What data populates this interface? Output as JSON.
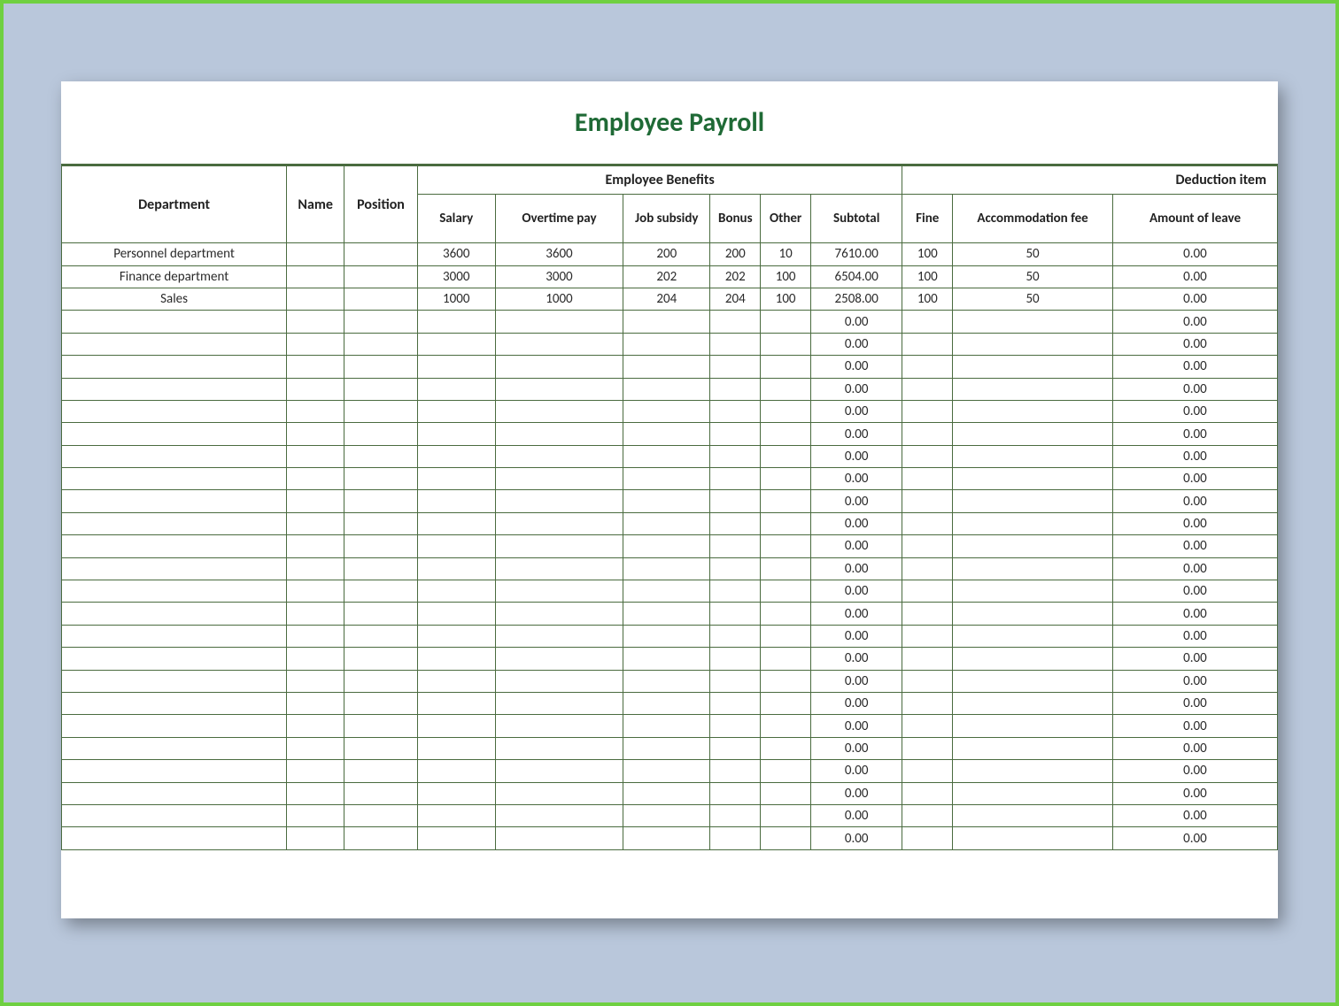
{
  "title": "Employee Payroll",
  "headers": {
    "department": "Department",
    "name": "Name",
    "position": "Position",
    "benefits_group": "Employee Benefits",
    "deduction_group": "Deduction item",
    "salary": "Salary",
    "overtime": "Overtime pay",
    "job_subsidy": "Job subsidy",
    "bonus": "Bonus",
    "other": "Other",
    "subtotal": "Subtotal",
    "fine": "Fine",
    "accommodation": "Accommodation fee",
    "leave": "Amount of leave"
  },
  "rows": [
    {
      "department": "Personnel department",
      "name": "",
      "position": "",
      "salary": "3600",
      "overtime": "3600",
      "job_subsidy": "200",
      "bonus": "200",
      "other": "10",
      "subtotal": "7610.00",
      "fine": "100",
      "accommodation": "50",
      "leave": "0.00"
    },
    {
      "department": "Finance department",
      "name": "",
      "position": "",
      "salary": "3000",
      "overtime": "3000",
      "job_subsidy": "202",
      "bonus": "202",
      "other": "100",
      "subtotal": "6504.00",
      "fine": "100",
      "accommodation": "50",
      "leave": "0.00"
    },
    {
      "department": "Sales",
      "name": "",
      "position": "",
      "salary": "1000",
      "overtime": "1000",
      "job_subsidy": "204",
      "bonus": "204",
      "other": "100",
      "subtotal": "2508.00",
      "fine": "100",
      "accommodation": "50",
      "leave": "0.00"
    },
    {
      "department": "",
      "name": "",
      "position": "",
      "salary": "",
      "overtime": "",
      "job_subsidy": "",
      "bonus": "",
      "other": "",
      "subtotal": "0.00",
      "fine": "",
      "accommodation": "",
      "leave": "0.00"
    },
    {
      "department": "",
      "name": "",
      "position": "",
      "salary": "",
      "overtime": "",
      "job_subsidy": "",
      "bonus": "",
      "other": "",
      "subtotal": "0.00",
      "fine": "",
      "accommodation": "",
      "leave": "0.00"
    },
    {
      "department": "",
      "name": "",
      "position": "",
      "salary": "",
      "overtime": "",
      "job_subsidy": "",
      "bonus": "",
      "other": "",
      "subtotal": "0.00",
      "fine": "",
      "accommodation": "",
      "leave": "0.00"
    },
    {
      "department": "",
      "name": "",
      "position": "",
      "salary": "",
      "overtime": "",
      "job_subsidy": "",
      "bonus": "",
      "other": "",
      "subtotal": "0.00",
      "fine": "",
      "accommodation": "",
      "leave": "0.00"
    },
    {
      "department": "",
      "name": "",
      "position": "",
      "salary": "",
      "overtime": "",
      "job_subsidy": "",
      "bonus": "",
      "other": "",
      "subtotal": "0.00",
      "fine": "",
      "accommodation": "",
      "leave": "0.00"
    },
    {
      "department": "",
      "name": "",
      "position": "",
      "salary": "",
      "overtime": "",
      "job_subsidy": "",
      "bonus": "",
      "other": "",
      "subtotal": "0.00",
      "fine": "",
      "accommodation": "",
      "leave": "0.00"
    },
    {
      "department": "",
      "name": "",
      "position": "",
      "salary": "",
      "overtime": "",
      "job_subsidy": "",
      "bonus": "",
      "other": "",
      "subtotal": "0.00",
      "fine": "",
      "accommodation": "",
      "leave": "0.00"
    },
    {
      "department": "",
      "name": "",
      "position": "",
      "salary": "",
      "overtime": "",
      "job_subsidy": "",
      "bonus": "",
      "other": "",
      "subtotal": "0.00",
      "fine": "",
      "accommodation": "",
      "leave": "0.00"
    },
    {
      "department": "",
      "name": "",
      "position": "",
      "salary": "",
      "overtime": "",
      "job_subsidy": "",
      "bonus": "",
      "other": "",
      "subtotal": "0.00",
      "fine": "",
      "accommodation": "",
      "leave": "0.00"
    },
    {
      "department": "",
      "name": "",
      "position": "",
      "salary": "",
      "overtime": "",
      "job_subsidy": "",
      "bonus": "",
      "other": "",
      "subtotal": "0.00",
      "fine": "",
      "accommodation": "",
      "leave": "0.00"
    },
    {
      "department": "",
      "name": "",
      "position": "",
      "salary": "",
      "overtime": "",
      "job_subsidy": "",
      "bonus": "",
      "other": "",
      "subtotal": "0.00",
      "fine": "",
      "accommodation": "",
      "leave": "0.00"
    },
    {
      "department": "",
      "name": "",
      "position": "",
      "salary": "",
      "overtime": "",
      "job_subsidy": "",
      "bonus": "",
      "other": "",
      "subtotal": "0.00",
      "fine": "",
      "accommodation": "",
      "leave": "0.00"
    },
    {
      "department": "",
      "name": "",
      "position": "",
      "salary": "",
      "overtime": "",
      "job_subsidy": "",
      "bonus": "",
      "other": "",
      "subtotal": "0.00",
      "fine": "",
      "accommodation": "",
      "leave": "0.00"
    },
    {
      "department": "",
      "name": "",
      "position": "",
      "salary": "",
      "overtime": "",
      "job_subsidy": "",
      "bonus": "",
      "other": "",
      "subtotal": "0.00",
      "fine": "",
      "accommodation": "",
      "leave": "0.00"
    },
    {
      "department": "",
      "name": "",
      "position": "",
      "salary": "",
      "overtime": "",
      "job_subsidy": "",
      "bonus": "",
      "other": "",
      "subtotal": "0.00",
      "fine": "",
      "accommodation": "",
      "leave": "0.00"
    },
    {
      "department": "",
      "name": "",
      "position": "",
      "salary": "",
      "overtime": "",
      "job_subsidy": "",
      "bonus": "",
      "other": "",
      "subtotal": "0.00",
      "fine": "",
      "accommodation": "",
      "leave": "0.00"
    },
    {
      "department": "",
      "name": "",
      "position": "",
      "salary": "",
      "overtime": "",
      "job_subsidy": "",
      "bonus": "",
      "other": "",
      "subtotal": "0.00",
      "fine": "",
      "accommodation": "",
      "leave": "0.00"
    },
    {
      "department": "",
      "name": "",
      "position": "",
      "salary": "",
      "overtime": "",
      "job_subsidy": "",
      "bonus": "",
      "other": "",
      "subtotal": "0.00",
      "fine": "",
      "accommodation": "",
      "leave": "0.00"
    },
    {
      "department": "",
      "name": "",
      "position": "",
      "salary": "",
      "overtime": "",
      "job_subsidy": "",
      "bonus": "",
      "other": "",
      "subtotal": "0.00",
      "fine": "",
      "accommodation": "",
      "leave": "0.00"
    },
    {
      "department": "",
      "name": "",
      "position": "",
      "salary": "",
      "overtime": "",
      "job_subsidy": "",
      "bonus": "",
      "other": "",
      "subtotal": "0.00",
      "fine": "",
      "accommodation": "",
      "leave": "0.00"
    },
    {
      "department": "",
      "name": "",
      "position": "",
      "salary": "",
      "overtime": "",
      "job_subsidy": "",
      "bonus": "",
      "other": "",
      "subtotal": "0.00",
      "fine": "",
      "accommodation": "",
      "leave": "0.00"
    },
    {
      "department": "",
      "name": "",
      "position": "",
      "salary": "",
      "overtime": "",
      "job_subsidy": "",
      "bonus": "",
      "other": "",
      "subtotal": "0.00",
      "fine": "",
      "accommodation": "",
      "leave": "0.00"
    },
    {
      "department": "",
      "name": "",
      "position": "",
      "salary": "",
      "overtime": "",
      "job_subsidy": "",
      "bonus": "",
      "other": "",
      "subtotal": "0.00",
      "fine": "",
      "accommodation": "",
      "leave": "0.00"
    },
    {
      "department": "",
      "name": "",
      "position": "",
      "salary": "",
      "overtime": "",
      "job_subsidy": "",
      "bonus": "",
      "other": "",
      "subtotal": "0.00",
      "fine": "",
      "accommodation": "",
      "leave": "0.00"
    }
  ]
}
